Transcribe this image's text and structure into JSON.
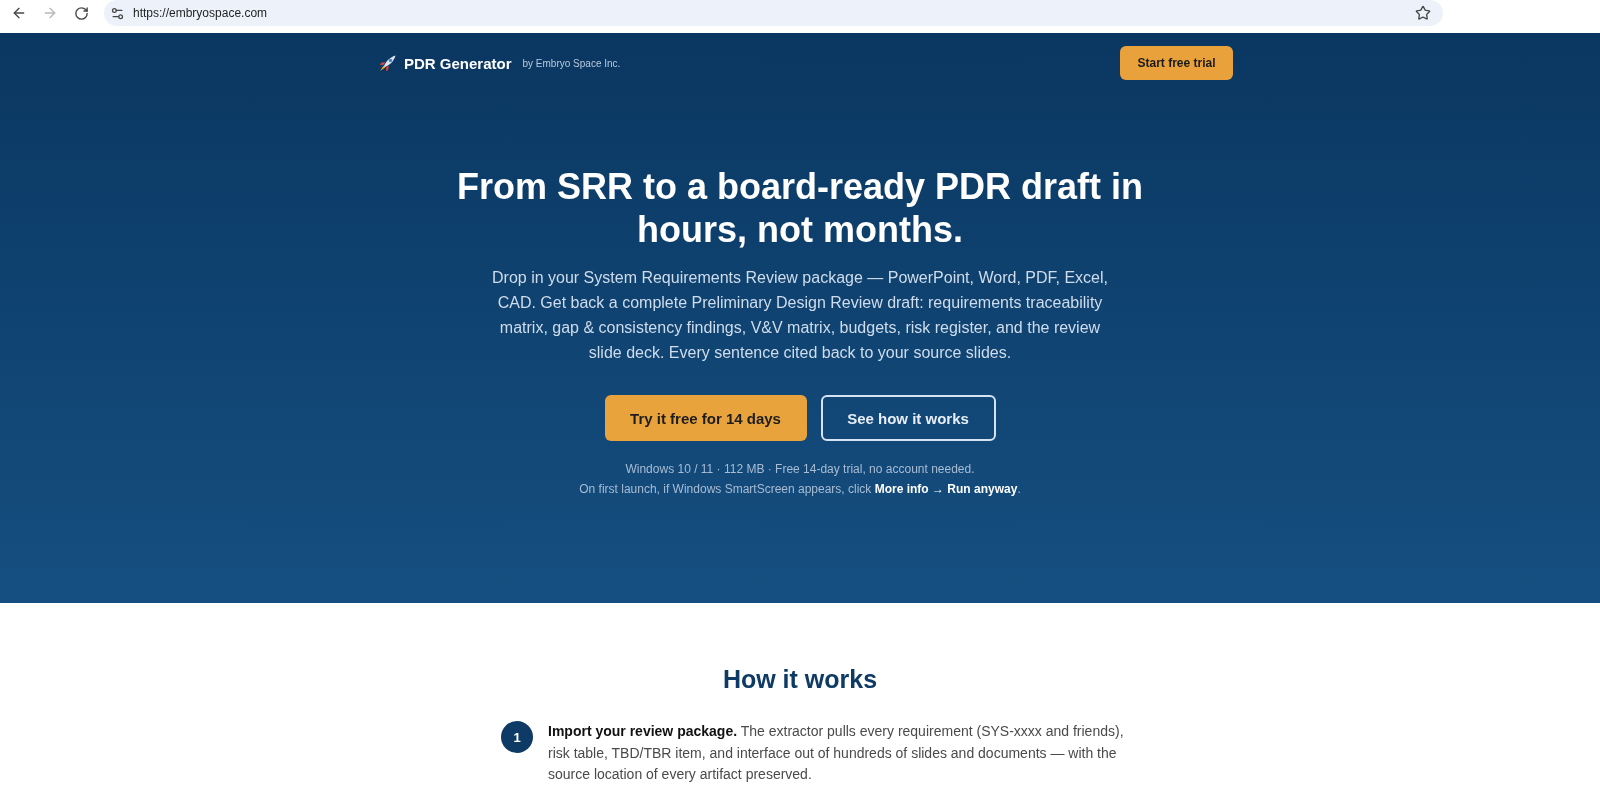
{
  "browser": {
    "url": "https://embryospace.com",
    "forward_disabled": true
  },
  "header": {
    "brand": "PDR Generator",
    "byline": "by Embryo Space Inc.",
    "cta": "Start free trial"
  },
  "hero": {
    "title": "From SRR to a board-ready PDR draft in hours, not months.",
    "lead": "Drop in your System Requirements Review package — PowerPoint, Word, PDF, Excel, CAD. Get back a complete Preliminary Design Review draft: requirements traceability matrix, gap & consistency findings, V&V matrix, budgets, risk register, and the review slide deck. Every sentence cited back to your source slides.",
    "buttons": [
      {
        "label": "Try it free for 14 days",
        "kind": "primary"
      },
      {
        "label": "See how it works",
        "kind": "outline"
      }
    ],
    "notes": [
      "Windows 10 / 11 · 112 MB · Free 14-day trial, no account needed.",
      "On first launch, if Windows SmartScreen appears, click **More info → Run anyway**."
    ]
  },
  "how_it_works": {
    "title": "How it works",
    "steps": [
      {
        "number": "1",
        "text": "**Import your review package.** The extractor pulls every requirement (SYS-xxxx and friends), risk table, TBD/TBR item, and interface out of hundreds of slides and documents — with the source location of every artifact preserved."
      }
    ]
  }
}
